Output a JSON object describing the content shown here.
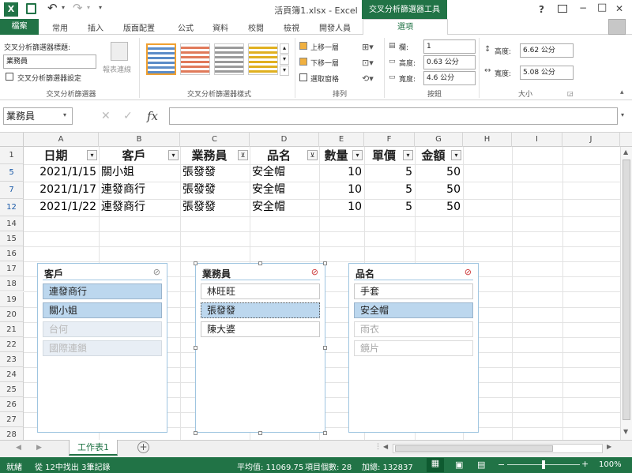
{
  "window": {
    "title": "活頁簿1.xlsx - Excel",
    "context_tab_title": "交叉分析篩選器工具",
    "help": "?",
    "min": "−",
    "max": "□",
    "close": "✕"
  },
  "qat": {
    "logo": "X",
    "save": "💾",
    "undo": "↶",
    "redo": "↷"
  },
  "tabs": [
    "檔案",
    "常用",
    "插入",
    "版面配置",
    "公式",
    "資料",
    "校閱",
    "檢視",
    "開發人員",
    "選項"
  ],
  "ribbon": {
    "slicer_caption_label": "交叉分析篩選器標題:",
    "slicer_caption_value": "業務員",
    "slicer_settings": "交叉分析篩選器設定",
    "report_conn": "報表連線",
    "group1": "交叉分析篩選器",
    "group2": "交叉分析篩選器樣式",
    "arrange": {
      "forward": "上移一層",
      "backward": "下移一層",
      "selection_pane": "選取窗格",
      "group": "排列"
    },
    "buttons": {
      "columns_label": "欄:",
      "columns_value": "1",
      "height_label": "高度:",
      "height_value": "0.63 公分",
      "width_label": "寬度:",
      "width_value": "4.6 公分",
      "group": "按鈕"
    },
    "size": {
      "height_label": "高度:",
      "height_value": "6.62 公分",
      "width_label": "寬度:",
      "width_value": "5.08 公分",
      "group": "大小"
    }
  },
  "formula_bar": {
    "name_box": "業務員",
    "fx": "fx",
    "cancel": "✕",
    "enter": "✓",
    "content": ""
  },
  "columns": [
    "A",
    "B",
    "C",
    "D",
    "E",
    "F",
    "G",
    "H",
    "I",
    "J"
  ],
  "rows": [
    "1",
    "5",
    "7",
    "12",
    "14",
    "15",
    "16",
    "17",
    "18",
    "19",
    "20",
    "21",
    "22",
    "23",
    "24",
    "25",
    "26",
    "27",
    "28"
  ],
  "table": {
    "headers": [
      "日期",
      "客戶",
      "業務員",
      "品名",
      "數量",
      "單價",
      "金額"
    ],
    "data": [
      [
        "2021/1/15",
        "關小姐",
        "張發發",
        "安全帽",
        "10",
        "5",
        "50"
      ],
      [
        "2021/1/17",
        "連發商行",
        "張發發",
        "安全帽",
        "10",
        "5",
        "50"
      ],
      [
        "2021/1/22",
        "連發商行",
        "張發發",
        "安全帽",
        "10",
        "5",
        "50"
      ]
    ]
  },
  "slicers": [
    {
      "title": "客戶",
      "items": [
        "連發商行",
        "關小姐",
        "台何",
        "國際連鎖"
      ]
    },
    {
      "title": "業務員",
      "items": [
        "林旺旺",
        "張發發",
        "陳大婆"
      ]
    },
    {
      "title": "品名",
      "items": [
        "手套",
        "安全帽",
        "雨衣",
        "鏡片"
      ]
    }
  ],
  "sheet_tab": "工作表1",
  "status": {
    "ready": "就緒",
    "found": "從 12中找出 3筆記錄",
    "avg": "平均值: 11069.75",
    "count": "項目個數: 28",
    "sum": "加總: 132837",
    "zoom": "100%",
    "minus": "−",
    "plus": "+"
  }
}
